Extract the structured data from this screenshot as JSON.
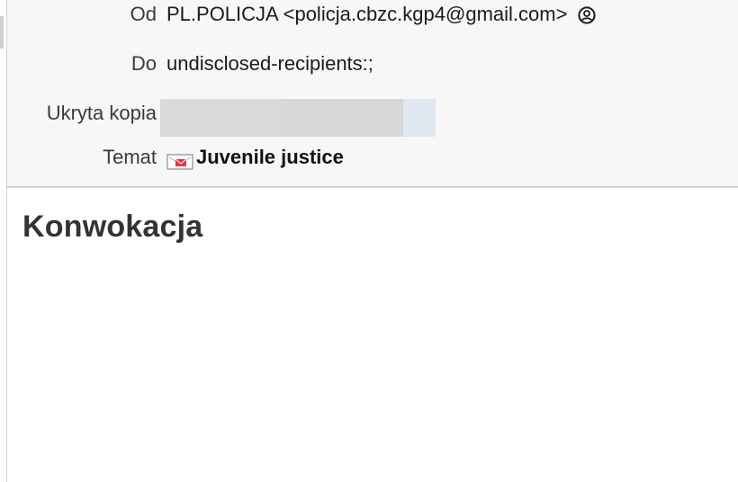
{
  "header": {
    "from": {
      "label": "Od",
      "value": "PL.POLICJA <policja.cbzc.kgp4@gmail.com>",
      "icon": "contact-icon"
    },
    "to": {
      "label": "Do",
      "value": "undisclosed-recipients:;"
    },
    "bcc": {
      "label": "Ukryta kopia",
      "value_redacted": true
    },
    "subject": {
      "label": "Temat",
      "value": "Juvenile justice",
      "icon": "message-icon"
    }
  },
  "body": {
    "heading": "Konwokacja"
  },
  "colors": {
    "header_bg": "#f7f7f7",
    "body_bg": "#ffffff",
    "label_text": "#3a3a3a",
    "value_text": "#1b1b1b",
    "heading_text": "#333333",
    "redaction_gray": "#dadada",
    "redaction_blue": "#dfe8f1"
  }
}
